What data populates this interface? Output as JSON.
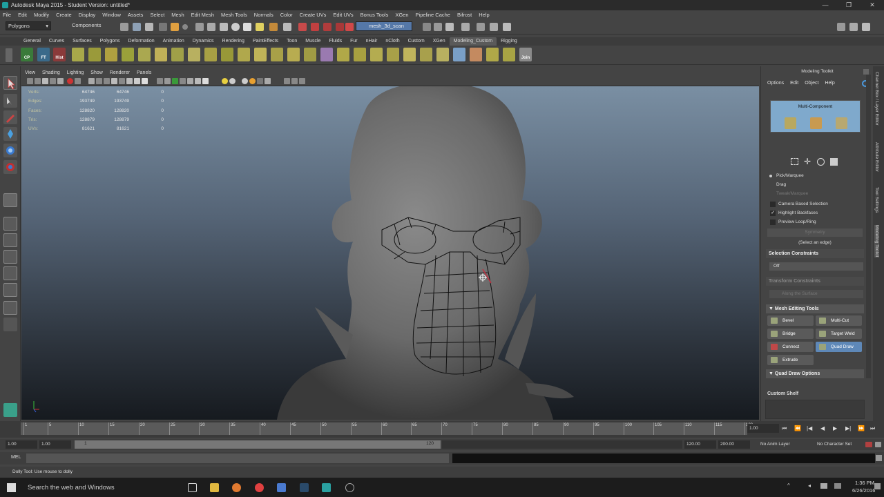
{
  "window": {
    "title": "Autodesk Maya 2015 - Student Version: untitled*",
    "controls": [
      "—",
      "❐",
      "✕"
    ]
  },
  "menubar": [
    "File",
    "Edit",
    "Modify",
    "Create",
    "Display",
    "Window",
    "Assets",
    "Select",
    "Mesh",
    "Edit Mesh",
    "Mesh Tools",
    "Normals",
    "Color",
    "Create UVs",
    "Edit UVs",
    "Bonus Tools",
    "XGen",
    "Pipeline Cache",
    "Bifrost",
    "Help"
  ],
  "status_line": {
    "menu_set": "Polygons",
    "selection_mode": "Components",
    "live_object": "mesh_3d_scan"
  },
  "shelf": {
    "tabs": [
      "General",
      "Curves",
      "Surfaces",
      "Polygons",
      "Deformation",
      "Animation",
      "Dynamics",
      "Rendering",
      "PaintEffects",
      "Toon",
      "Muscle",
      "Fluids",
      "Fur",
      "nHair",
      "nCloth",
      "Custom",
      "XGen",
      "Modeling_Custom",
      "Rigging"
    ],
    "active_tab": "Modeling_Custom",
    "buttons": [
      "CP",
      "FT",
      "Hist",
      "Join"
    ]
  },
  "viewport": {
    "menu": [
      "View",
      "Shading",
      "Lighting",
      "Show",
      "Renderer",
      "Panels"
    ],
    "hud": [
      {
        "label": "Verts:",
        "a": "64746",
        "b": "64746",
        "c": "0"
      },
      {
        "label": "Edges:",
        "a": "193749",
        "b": "193749",
        "c": "0"
      },
      {
        "label": "Faces:",
        "a": "128820",
        "b": "128820",
        "c": "0"
      },
      {
        "label": "Tris:",
        "a": "128879",
        "b": "128879",
        "c": "0"
      },
      {
        "label": "UVs:",
        "a": "81621",
        "b": "81621",
        "c": "0"
      }
    ]
  },
  "modeling_toolkit": {
    "title": "Modeling Toolkit",
    "menu": [
      "Options",
      "Edit",
      "Object",
      "Help"
    ],
    "mode": "Multi-Component",
    "options": {
      "pick": "Pick/Marquee",
      "drag": "Drag",
      "tweak": "Tweak/Marquee"
    },
    "checkboxes": [
      {
        "label": "Camera Based Selection",
        "checked": false
      },
      {
        "label": "Highlight Backfaces",
        "checked": true
      },
      {
        "label": "Preview Loop/Ring",
        "checked": false
      }
    ],
    "symmetry": "Symmetry",
    "select_hint": "(Select an edge)",
    "selection_constraints": "Selection Constraints",
    "constraint_value": "Off",
    "transform_constraints": "Transform Constraints",
    "transform_value": "Along the Surface",
    "mesh_editing_tools": "Mesh Editing Tools",
    "tools": [
      "Bevel",
      "Multi-Cut",
      "Bridge",
      "Target Weld",
      "Connect",
      "Quad Draw",
      "Extrude"
    ],
    "selected_tool": "Quad Draw",
    "quad_draw_options": "Quad Draw Options",
    "custom_shelf": "Custom Shelf"
  },
  "right_tabs": [
    "Channel Box / Layer Editor",
    "Attribute Editor",
    "Tool Settings",
    "Modeling Toolkit"
  ],
  "timeline": {
    "ticks": [
      "1",
      "5",
      "10",
      "15",
      "20",
      "25",
      "30",
      "35",
      "40",
      "45",
      "50",
      "55",
      "60",
      "65",
      "70",
      "75",
      "80",
      "85",
      "90",
      "95",
      "100",
      "105",
      "110",
      "115",
      "120"
    ],
    "current_frame": "1.00",
    "playback": [
      "⏮",
      "⏪",
      "|◀",
      "◀",
      "▶",
      "▶|",
      "⏩",
      "⏭"
    ]
  },
  "range": {
    "start": "1.00",
    "playback_start": "1.00",
    "slider_start": "1",
    "slider_end": "120",
    "playback_end": "120.00",
    "end": "200.00",
    "anim_layer": "No Anim Layer",
    "character_set": "No Character Set"
  },
  "command_line": {
    "label": "MEL"
  },
  "help_line": "Dolly Tool: Use mouse to dolly",
  "taskbar": {
    "search": "Search the web and Windows",
    "time": "1:36 PM",
    "date": "6/26/2016"
  }
}
